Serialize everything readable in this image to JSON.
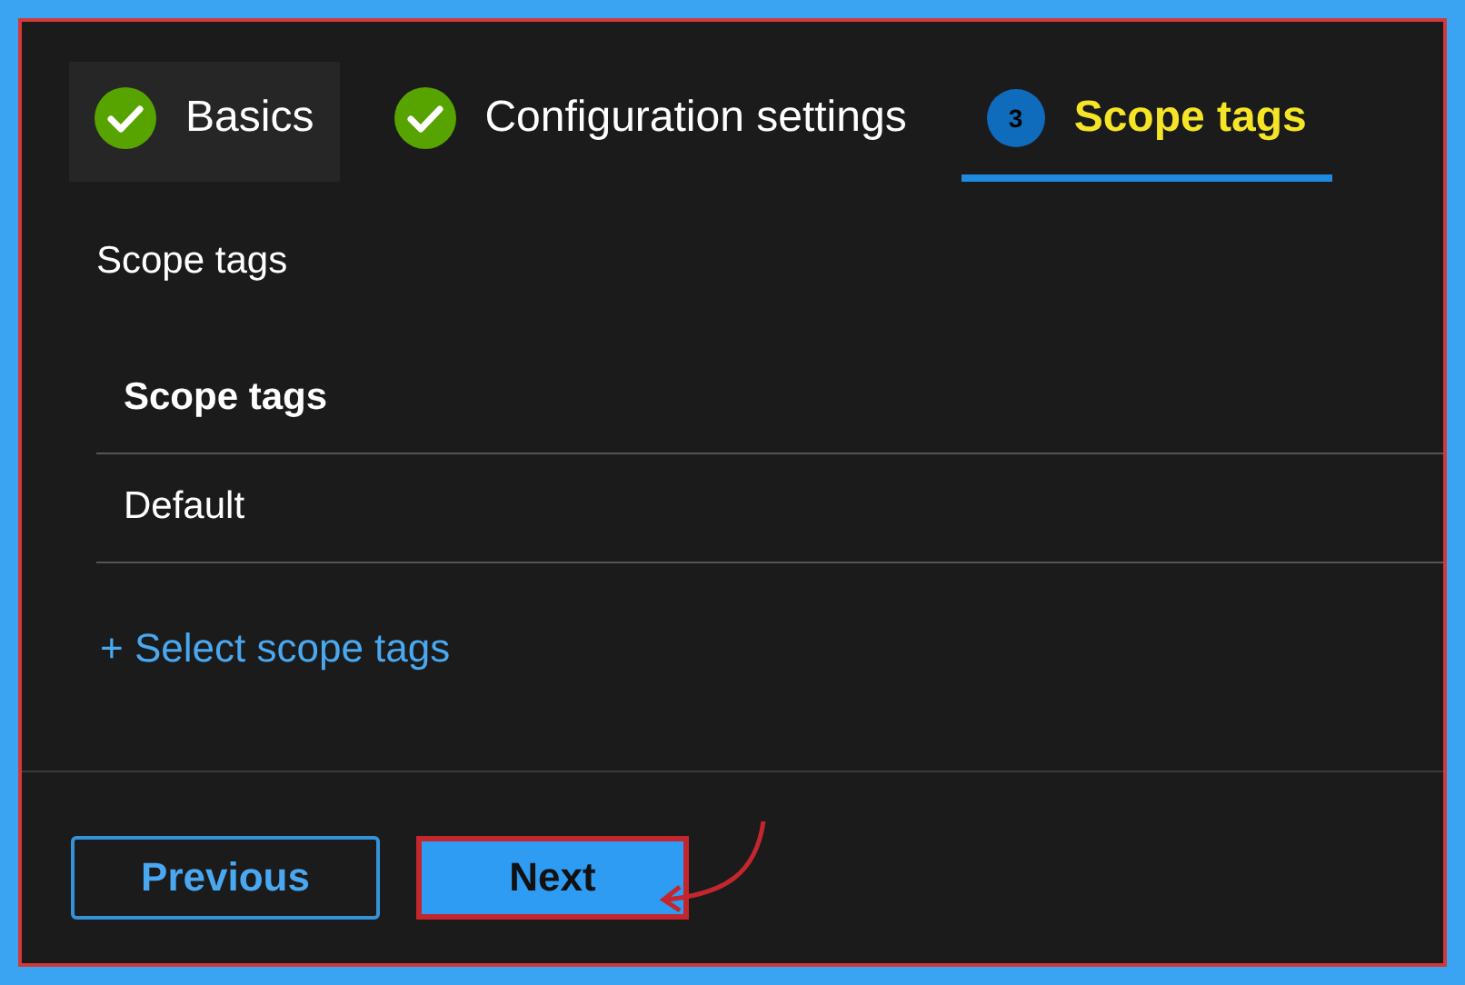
{
  "steps": [
    {
      "kind": "done",
      "label": "Basics",
      "selected": false
    },
    {
      "kind": "done",
      "label": "Configuration settings",
      "selected": false
    },
    {
      "kind": "current",
      "number": "3",
      "label": "Scope tags",
      "selected": true
    }
  ],
  "section_title": "Scope tags",
  "table": {
    "columns": [
      "Scope tags"
    ],
    "rows": [
      "Default"
    ]
  },
  "link": "+ Select scope tags",
  "buttons": [
    {
      "label": "Previous",
      "kind": "secondary"
    },
    {
      "label": "Next",
      "kind": "primary"
    }
  ]
}
